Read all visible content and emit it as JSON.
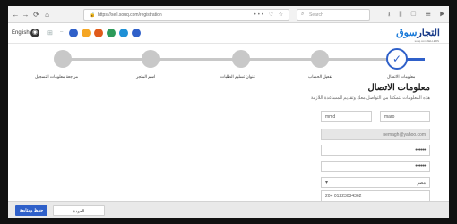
{
  "browser": {
    "nav": {
      "back": "←",
      "forward": "→",
      "reload": "⟳",
      "home": "⌂"
    },
    "url": "https://sell.souq.com/registration",
    "url_actions": "••• ♡ ☆",
    "search_placeholder": "Search",
    "toolbar_icons": "⭳ ⫼ ▢ ☰ ▶ ≡"
  },
  "header": {
    "language": "English",
    "logo_ar": "التجار",
    "logo_en": "سوق",
    "logo_sub": "souq.com SELLERS",
    "dot_colors": [
      "#2f60c9",
      "#f5a623",
      "#e05a1a",
      "#2d9a5a",
      "#1e90d6",
      "#2f60c9"
    ]
  },
  "stepper": {
    "active_color": "#2f60c9",
    "steps": [
      {
        "label": "معلومات الاتصال",
        "state": "current"
      },
      {
        "label": "تفعيل الحساب",
        "state": "pending"
      },
      {
        "label": "عنوان تسليم الطلبات",
        "state": "pending"
      },
      {
        "label": "اسم المتجر",
        "state": "pending"
      },
      {
        "label": "مراجعة معلومات التسجيل",
        "state": "pending"
      }
    ]
  },
  "form": {
    "title": "معلومات الاتصال",
    "subtitle": "هذه المعلومات لتمكننا من التواصل معك وتقديم المساعدة اللازمة",
    "first_name": "maro",
    "last_name": "mmd",
    "email": "nemagh@yahoo.com",
    "password": "••••••",
    "password_confirm": "••••••",
    "country": "مصر",
    "phone": "01223034362",
    "phone_code": "20+"
  },
  "footer": {
    "primary_button": "حفظ ومتابعة",
    "secondary_button": "العودة"
  }
}
